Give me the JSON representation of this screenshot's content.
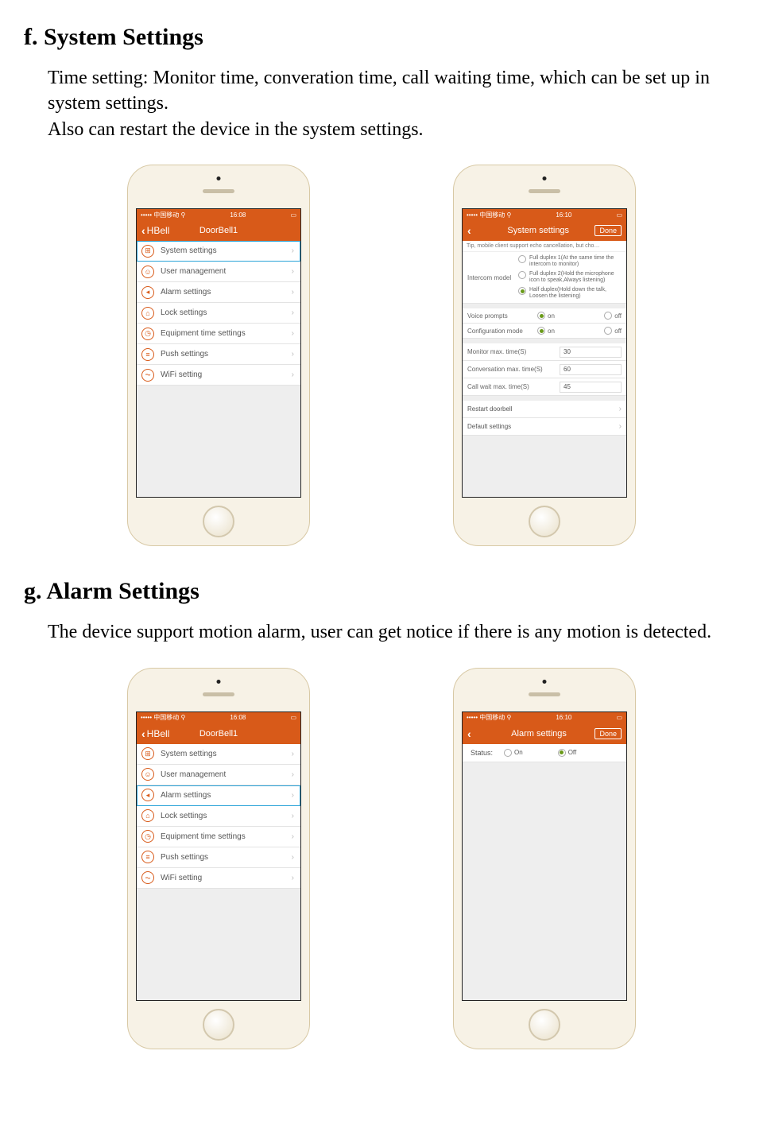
{
  "sections": {
    "f": {
      "heading": "f. System Settings",
      "body": "Time setting: Monitor time, converation time, call waiting time, which can be set up in system settings.\nAlso can restart the device in the system settings."
    },
    "g": {
      "heading": "g. Alarm Settings",
      "body": "The device support motion alarm, user can get notice if there is any motion is detected."
    }
  },
  "status": {
    "carrier": "••••• 中国移动 ⚲",
    "time_a": "16:08",
    "time_b": "16:10"
  },
  "main_list": {
    "back_label": "HBell",
    "title": "DoorBell1",
    "items": [
      {
        "icon": "⊞",
        "label": "System settings"
      },
      {
        "icon": "☺",
        "label": "User management"
      },
      {
        "icon": "◂",
        "label": "Alarm settings"
      },
      {
        "icon": "⌂",
        "label": "Lock settings"
      },
      {
        "icon": "◷",
        "label": "Equipment time settings"
      },
      {
        "icon": "≡",
        "label": "Push settings"
      },
      {
        "icon": "⏦",
        "label": "WiFi setting"
      }
    ]
  },
  "system_settings": {
    "title": "System settings",
    "done": "Done",
    "tip": "Tip, mobile client support echo cancellation, but cho…",
    "intercom_label": "Intercom model",
    "intercom_options": [
      "Full duplex 1(At the same time the intercom to monitor)",
      "Full duplex 2(Hold the microphone icon to speak,Always listening)",
      "Half duplex(Hold down the talk, Loosen the listening)"
    ],
    "intercom_selected": 2,
    "voice_prompts_label": "Voice prompts",
    "config_mode_label": "Configuration mode",
    "on": "on",
    "off": "off",
    "voice_prompts_value": "on",
    "config_mode_value": "on",
    "monitor_label": "Monitor max. time(S)",
    "monitor_value": "30",
    "conversation_label": "Conversation max. time(S)",
    "conversation_value": "60",
    "callwait_label": "Call wait max. time(S)",
    "callwait_value": "45",
    "restart_label": "Restart doorbell",
    "default_label": "Default settings"
  },
  "alarm_settings": {
    "title": "Alarm settings",
    "done": "Done",
    "status_label": "Status:",
    "on": "On",
    "off": "Off",
    "value": "Off"
  }
}
